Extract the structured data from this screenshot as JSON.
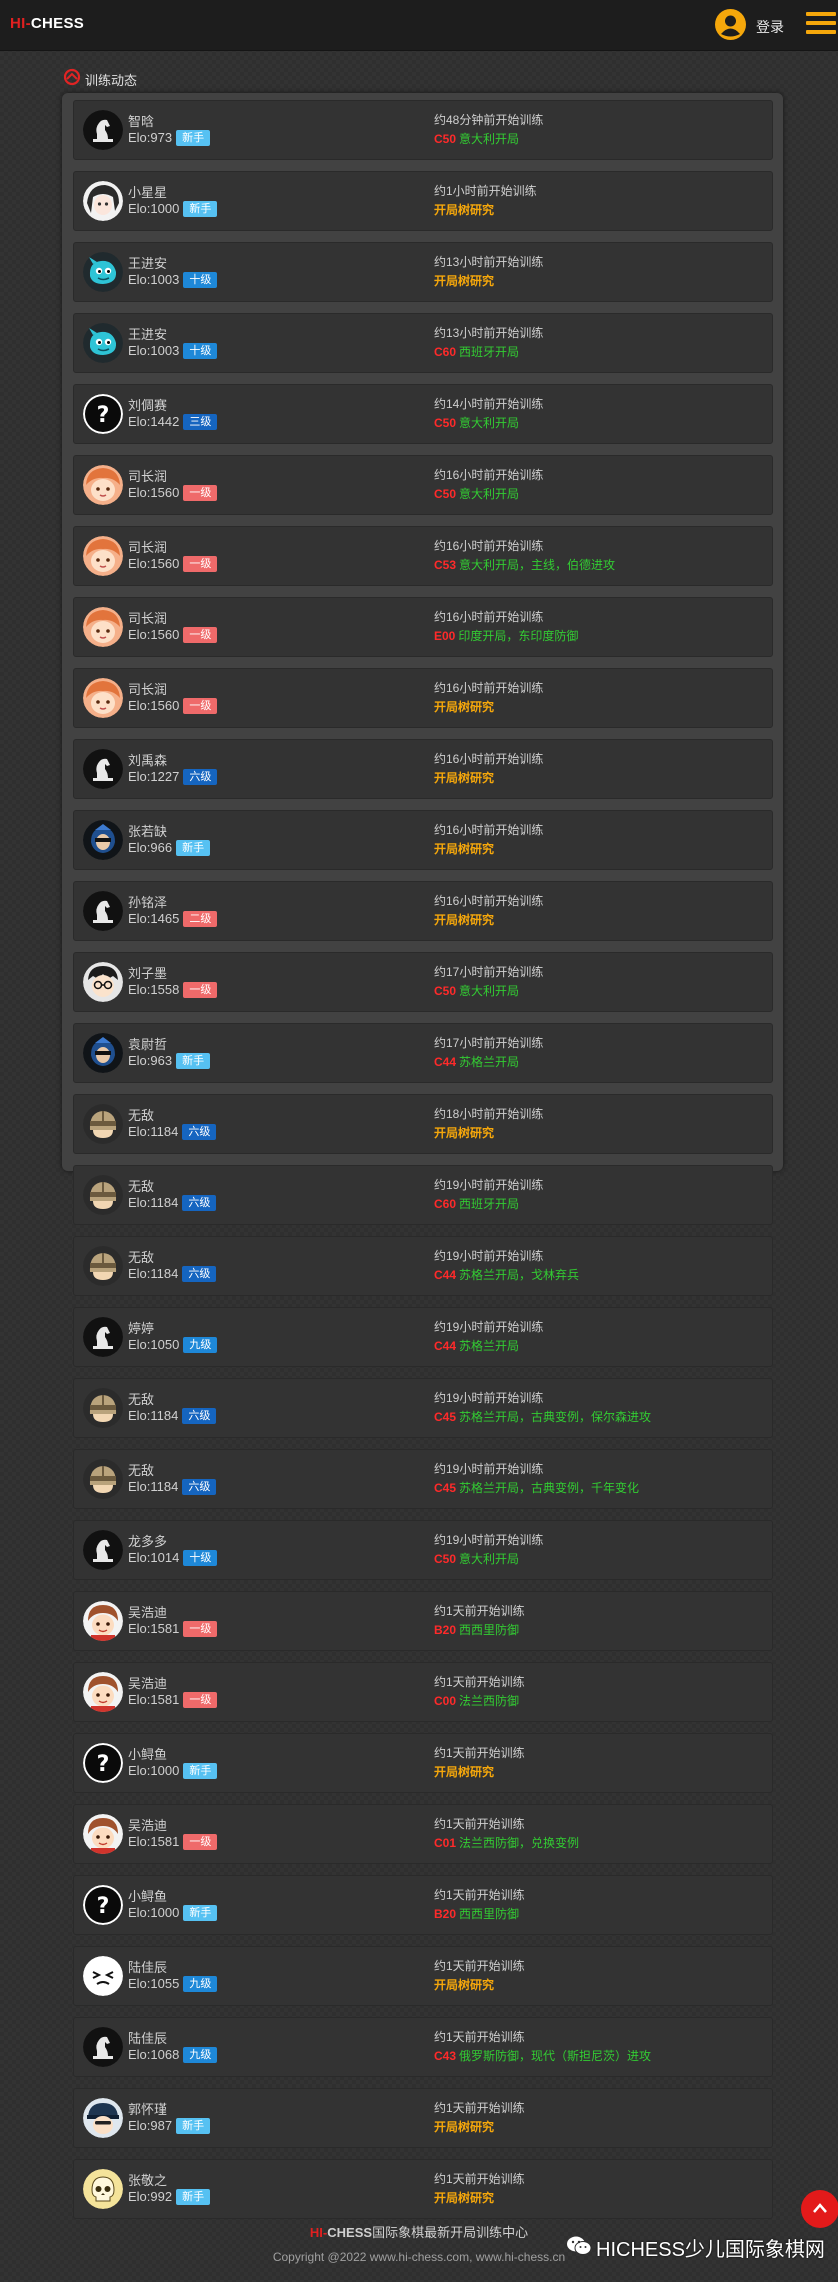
{
  "header": {
    "logo_hi": "HI-",
    "logo_chess": "CHESS",
    "login_label": "登录"
  },
  "section": {
    "title": "训练动态"
  },
  "colors": {
    "badge_新手": "#56c1f2",
    "badge_十级": "#1e88d8",
    "badge_九级": "#1e88d8",
    "badge_六级": "#1565c0",
    "badge_三级": "#1565c0",
    "badge_二级": "#ef6a6a",
    "badge_一级": "#ef6a6a"
  },
  "items": [
    {
      "name": "智晗",
      "elo": "Elo:973",
      "level": "新手",
      "avatar": "knight-logo",
      "time": "约48分钟前开始训练",
      "eco": "C50",
      "opening": "意大利开局"
    },
    {
      "name": "小星星",
      "elo": "Elo:1000",
      "level": "新手",
      "avatar": "anime-girl",
      "time": "约1小时前开始训练",
      "eco": "",
      "opening": "开局树研究"
    },
    {
      "name": "王进安",
      "elo": "Elo:1003",
      "level": "十级",
      "avatar": "cyan-monster",
      "time": "约13小时前开始训练",
      "eco": "",
      "opening": "开局树研究"
    },
    {
      "name": "王进安",
      "elo": "Elo:1003",
      "level": "十级",
      "avatar": "cyan-monster",
      "time": "约13小时前开始训练",
      "eco": "C60",
      "opening": "西班牙开局"
    },
    {
      "name": "刘倜赛",
      "elo": "Elo:1442",
      "level": "三级",
      "avatar": "question",
      "time": "约14小时前开始训练",
      "eco": "C50",
      "opening": "意大利开局"
    },
    {
      "name": "司长润",
      "elo": "Elo:1560",
      "level": "一级",
      "avatar": "orange-boy",
      "time": "约16小时前开始训练",
      "eco": "C50",
      "opening": "意大利开局"
    },
    {
      "name": "司长润",
      "elo": "Elo:1560",
      "level": "一级",
      "avatar": "orange-boy",
      "time": "约16小时前开始训练",
      "eco": "C53",
      "opening": "意大利开局，主线，伯德进攻"
    },
    {
      "name": "司长润",
      "elo": "Elo:1560",
      "level": "一级",
      "avatar": "orange-boy",
      "time": "约16小时前开始训练",
      "eco": "E00",
      "opening": "印度开局，东印度防御"
    },
    {
      "name": "司长润",
      "elo": "Elo:1560",
      "level": "一级",
      "avatar": "orange-boy",
      "time": "约16小时前开始训练",
      "eco": "",
      "opening": "开局树研究"
    },
    {
      "name": "刘禹森",
      "elo": "Elo:1227",
      "level": "六级",
      "avatar": "knight-logo",
      "time": "约16小时前开始训练",
      "eco": "",
      "opening": "开局树研究"
    },
    {
      "name": "张若缺",
      "elo": "Elo:966",
      "level": "新手",
      "avatar": "blue-hero",
      "time": "约16小时前开始训练",
      "eco": "",
      "opening": "开局树研究"
    },
    {
      "name": "孙铭泽",
      "elo": "Elo:1465",
      "level": "二级",
      "avatar": "knight-logo",
      "time": "约16小时前开始训练",
      "eco": "",
      "opening": "开局树研究"
    },
    {
      "name": "刘子墨",
      "elo": "Elo:1558",
      "level": "一级",
      "avatar": "glasses-boy",
      "time": "约17小时前开始训练",
      "eco": "C50",
      "opening": "意大利开局"
    },
    {
      "name": "袁尉哲",
      "elo": "Elo:963",
      "level": "新手",
      "avatar": "blue-hero",
      "time": "约17小时前开始训练",
      "eco": "C44",
      "opening": "苏格兰开局"
    },
    {
      "name": "无敌",
      "elo": "Elo:1184",
      "level": "六级",
      "avatar": "helmet-knight",
      "time": "约18小时前开始训练",
      "eco": "",
      "opening": "开局树研究"
    },
    {
      "name": "无敌",
      "elo": "Elo:1184",
      "level": "六级",
      "avatar": "helmet-knight",
      "time": "约19小时前开始训练",
      "eco": "C60",
      "opening": "西班牙开局"
    },
    {
      "name": "无敌",
      "elo": "Elo:1184",
      "level": "六级",
      "avatar": "helmet-knight",
      "time": "约19小时前开始训练",
      "eco": "C44",
      "opening": "苏格兰开局，戈林弃兵"
    },
    {
      "name": "婷婷",
      "elo": "Elo:1050",
      "level": "九级",
      "avatar": "knight-logo",
      "time": "约19小时前开始训练",
      "eco": "C44",
      "opening": "苏格兰开局"
    },
    {
      "name": "无敌",
      "elo": "Elo:1184",
      "level": "六级",
      "avatar": "helmet-knight",
      "time": "约19小时前开始训练",
      "eco": "C45",
      "opening": "苏格兰开局，古典变例，保尔森进攻"
    },
    {
      "name": "无敌",
      "elo": "Elo:1184",
      "level": "六级",
      "avatar": "helmet-knight",
      "time": "约19小时前开始训练",
      "eco": "C45",
      "opening": "苏格兰开局，古典变例，千年变化"
    },
    {
      "name": "龙多多",
      "elo": "Elo:1014",
      "level": "十级",
      "avatar": "knight-logo",
      "time": "约19小时前开始训练",
      "eco": "C50",
      "opening": "意大利开局"
    },
    {
      "name": "吴浩迪",
      "elo": "Elo:1581",
      "level": "一级",
      "avatar": "brown-boy",
      "time": "约1天前开始训练",
      "eco": "B20",
      "opening": "西西里防御"
    },
    {
      "name": "吴浩迪",
      "elo": "Elo:1581",
      "level": "一级",
      "avatar": "brown-boy",
      "time": "约1天前开始训练",
      "eco": "C00",
      "opening": "法兰西防御"
    },
    {
      "name": "小鲟鱼",
      "elo": "Elo:1000",
      "level": "新手",
      "avatar": "question",
      "time": "约1天前开始训练",
      "eco": "",
      "opening": "开局树研究"
    },
    {
      "name": "吴浩迪",
      "elo": "Elo:1581",
      "level": "一级",
      "avatar": "brown-boy",
      "time": "约1天前开始训练",
      "eco": "C01",
      "opening": "法兰西防御，兑换变例"
    },
    {
      "name": "小鲟鱼",
      "elo": "Elo:1000",
      "level": "新手",
      "avatar": "question",
      "time": "约1天前开始训练",
      "eco": "B20",
      "opening": "西西里防御"
    },
    {
      "name": "陆佳辰",
      "elo": "Elo:1055",
      "level": "九级",
      "avatar": "white-face",
      "time": "约1天前开始训练",
      "eco": "",
      "opening": "开局树研究"
    },
    {
      "name": "陆佳辰",
      "elo": "Elo:1068",
      "level": "九级",
      "avatar": "knight-logo",
      "time": "约1天前开始训练",
      "eco": "C43",
      "opening": "俄罗斯防御，现代（斯担尼茨）进攻"
    },
    {
      "name": "郭怀瑾",
      "elo": "Elo:987",
      "level": "新手",
      "avatar": "cap-boy",
      "time": "约1天前开始训练",
      "eco": "",
      "opening": "开局树研究"
    },
    {
      "name": "张敬之",
      "elo": "Elo:992",
      "level": "新手",
      "avatar": "yellow-skull",
      "time": "约1天前开始训练",
      "eco": "",
      "opening": "开局树研究"
    }
  ],
  "footer": {
    "line1_hi": "HI-",
    "line1_chess": "CHESS",
    "line1_text": "国际象棋最新开局训练中心",
    "copyright": "Copyright @2022 www.hi-chess.com, www.hi-chess.cn",
    "wechat_text": "HICHESS少儿国际象棋网"
  }
}
